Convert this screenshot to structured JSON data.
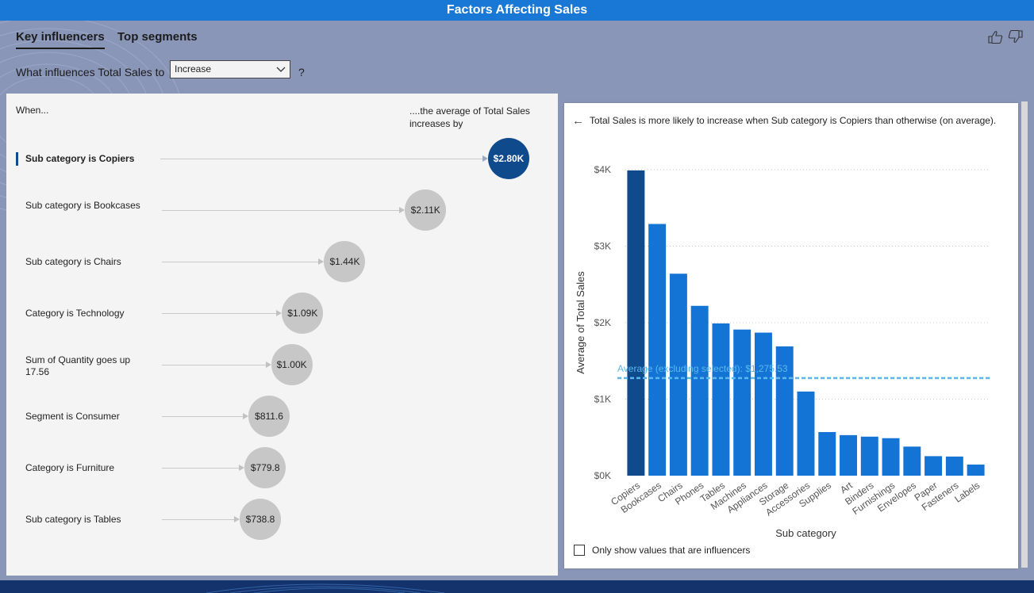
{
  "title": "Factors Affecting Sales",
  "tabs": [
    {
      "label": "Key influencers"
    },
    {
      "label": "Top segments"
    }
  ],
  "question": {
    "prefix": "What influences Total Sales to",
    "dropdown_value": "Increase",
    "help": "?"
  },
  "left": {
    "when_label": "When...",
    "avg_label": "....the average of Total Sales increases by",
    "influencers": [
      {
        "label": "Sub category is Copiers",
        "value_text": "$2.80K",
        "value": 2800
      },
      {
        "label": "Sub category is Bookcases",
        "value_text": "$2.11K",
        "value": 2110
      },
      {
        "label": "Sub category is Chairs",
        "value_text": "$1.44K",
        "value": 1440
      },
      {
        "label": "Category is Technology",
        "value_text": "$1.09K",
        "value": 1090
      },
      {
        "label": "Sum of Quantity goes up 17.56",
        "value_text": "$1.00K",
        "value": 1000
      },
      {
        "label": "Segment is Consumer",
        "value_text": "$811.6",
        "value": 811.6
      },
      {
        "label": "Category is Furniture",
        "value_text": "$779.8",
        "value": 779.8
      },
      {
        "label": "Sub category is Tables",
        "value_text": "$738.8",
        "value": 738.8
      }
    ]
  },
  "detail": {
    "text": "Total Sales is more likely to increase when Sub category is Copiers than otherwise (on average).",
    "checkbox_label": "Only show values that are influencers"
  },
  "chart_data": {
    "type": "bar",
    "categories": [
      "Copiers",
      "Bookcases",
      "Chairs",
      "Phones",
      "Tables",
      "Machines",
      "Appliances",
      "Storage",
      "Accessories",
      "Supplies",
      "Art",
      "Binders",
      "Furnishings",
      "Envelopes",
      "Paper",
      "Fasteners",
      "Labels"
    ],
    "values": [
      3990,
      3290,
      2640,
      2220,
      1990,
      1910,
      1870,
      1690,
      1100,
      570,
      530,
      510,
      490,
      380,
      255,
      250,
      145
    ],
    "highlight_index": 0,
    "xlabel": "Sub category",
    "ylabel": "Average of Total Sales",
    "ylim": [
      0,
      4000
    ],
    "yticks": [
      0,
      1000,
      2000,
      3000,
      4000
    ],
    "ytick_labels": [
      "$0K",
      "$1K",
      "$2K",
      "$3K",
      "$4K"
    ],
    "grid": true,
    "reference_line": {
      "value": 1275.53,
      "label": "Average (excluding selected): $1,275.53"
    },
    "colors": {
      "bar": "#1474d6",
      "highlight": "#0e4a8c",
      "reference": "#5bb8ea"
    }
  }
}
